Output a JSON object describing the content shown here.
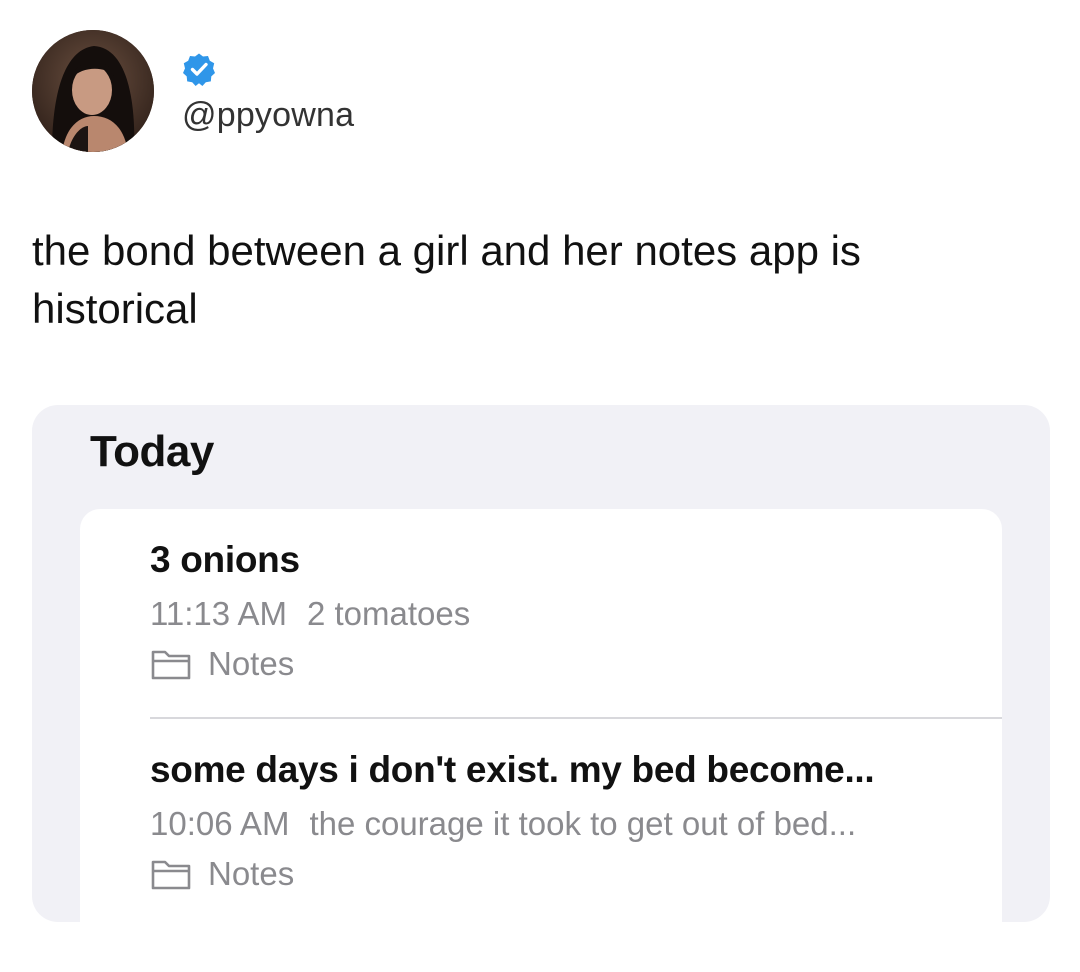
{
  "tweet": {
    "handle": "@ppyowna",
    "text": "the bond between a girl and her notes app is historical",
    "verified_icon": "verified-badge-icon",
    "verified_color": "#2f96e9"
  },
  "notes": {
    "section_title": "Today",
    "items": [
      {
        "title": "3 onions",
        "time": "11:13 AM",
        "preview": "2 tomatoes",
        "folder": "Notes",
        "folder_icon": "folder-icon"
      },
      {
        "title": "some days i don't exist. my bed become...",
        "time": "10:06 AM",
        "preview": "the courage it took to get out of bed...",
        "folder": "Notes",
        "folder_icon": "folder-icon"
      }
    ]
  }
}
